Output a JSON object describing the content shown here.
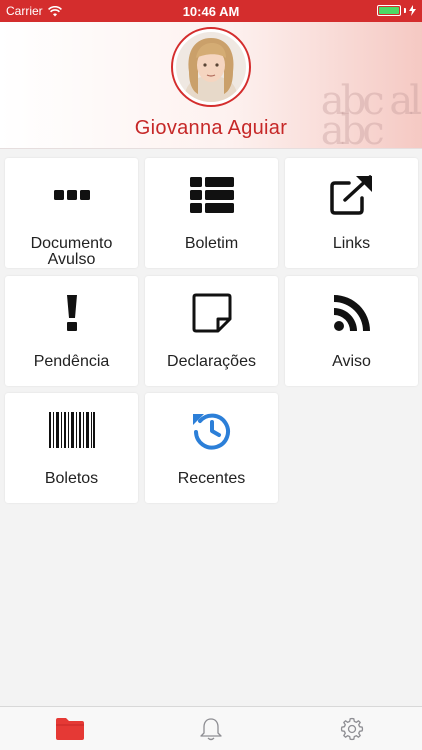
{
  "status_bar": {
    "carrier": "Carrier",
    "time": "10:46 AM",
    "battery_level": 1.0,
    "background_color": "#d42d2d",
    "battery_color": "#4cd964"
  },
  "profile": {
    "name": "Giovanna Aguiar",
    "name_color": "#c62828",
    "accent_color": "#d42d2d"
  },
  "menu": {
    "items": [
      {
        "label": "Documento\nAvulso",
        "icon": "ellipsis-icon"
      },
      {
        "label": "Boletim",
        "icon": "list-table-icon"
      },
      {
        "label": "Links",
        "icon": "external-link-icon"
      },
      {
        "label": "Pendência",
        "icon": "exclamation-icon"
      },
      {
        "label": "Declarações",
        "icon": "sticky-note-icon"
      },
      {
        "label": "Aviso",
        "icon": "rss-icon"
      },
      {
        "label": "Boletos",
        "icon": "barcode-icon"
      },
      {
        "label": "Recentes",
        "icon": "history-icon",
        "icon_color": "#2c7fd8"
      }
    ]
  },
  "tab_bar": {
    "tabs": [
      {
        "name": "folder",
        "icon": "folder-icon",
        "active": true,
        "color": "#e53935"
      },
      {
        "name": "notifications",
        "icon": "bell-icon",
        "active": false,
        "color": "#8e8e93"
      },
      {
        "name": "settings",
        "icon": "gear-icon",
        "active": false,
        "color": "#8e8e93"
      }
    ]
  }
}
